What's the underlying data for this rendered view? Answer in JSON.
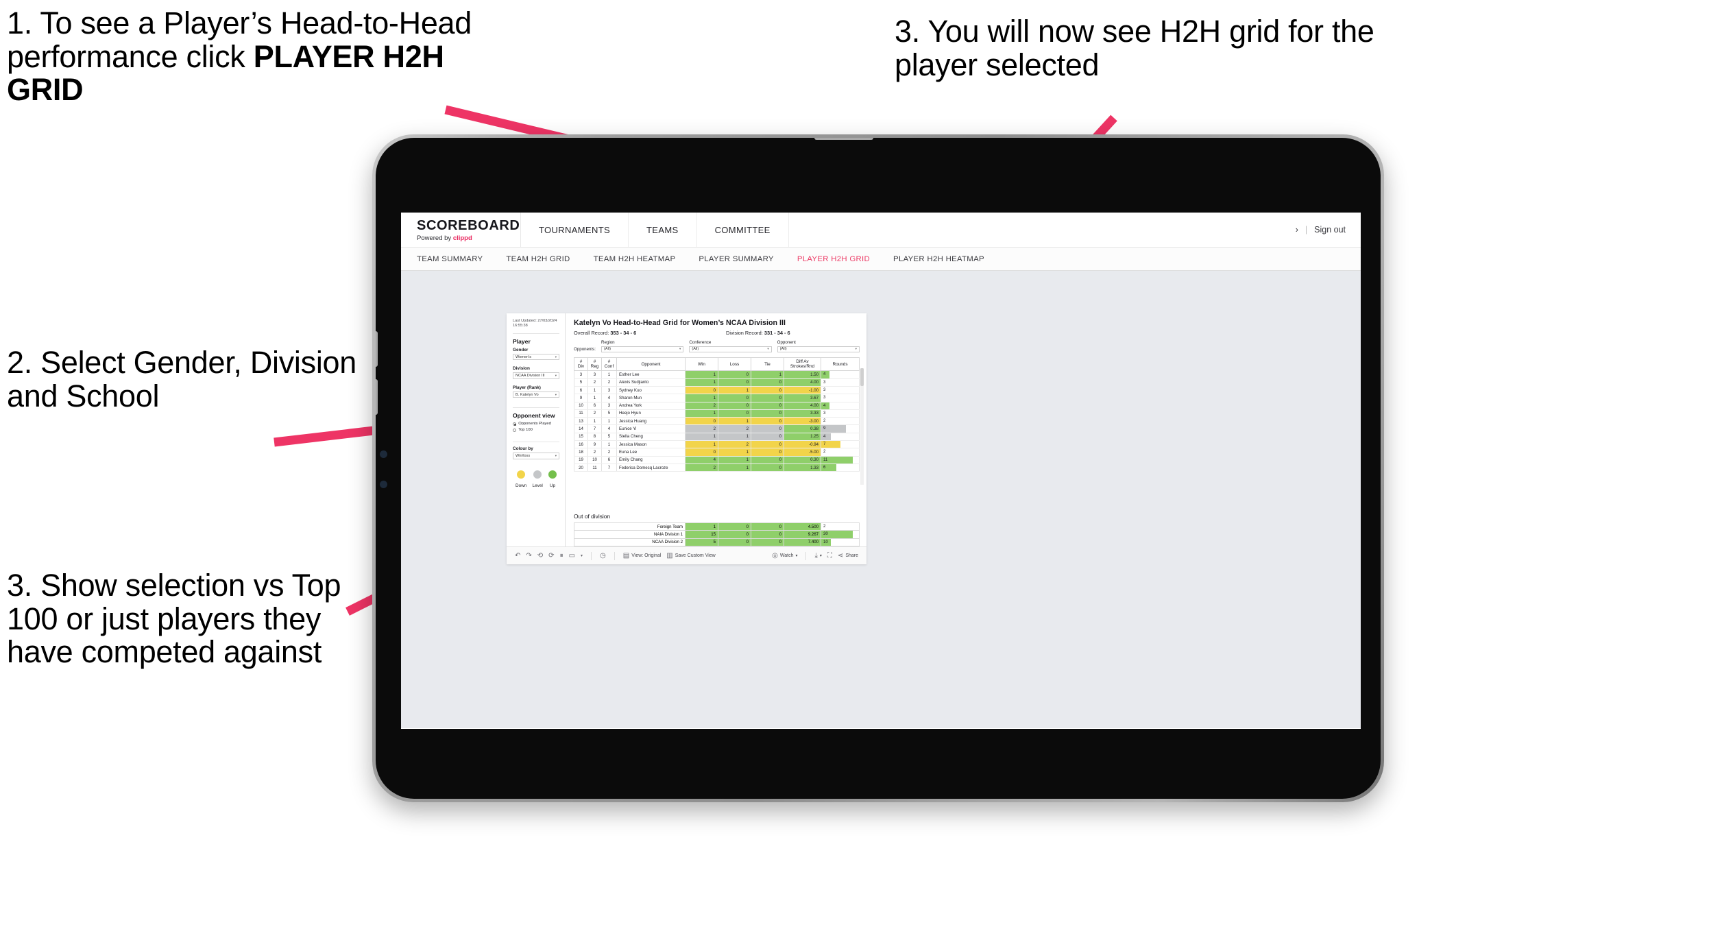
{
  "annotations": {
    "step1_pre": "1. To see a Player’s Head-to-Head performance click ",
    "step1_bold": "PLAYER H2H GRID",
    "step2": "2. Select Gender, Division and School",
    "step3_left": "3. Show selection vs Top 100 or just players they have competed against",
    "step3_right": "3. You will now see H2H grid for the player selected"
  },
  "app": {
    "brand": {
      "title": "SCOREBOARD",
      "powered_prefix": "Powered by ",
      "powered_brand": "clippd"
    },
    "topnav": [
      "TOURNAMENTS",
      "TEAMS",
      "COMMITTEE"
    ],
    "top_right": {
      "chevron": "›",
      "separator": "|",
      "sign_out": "Sign out"
    },
    "subnav": [
      {
        "label": "TEAM SUMMARY",
        "active": false
      },
      {
        "label": "TEAM H2H GRID",
        "active": false
      },
      {
        "label": "TEAM H2H HEATMAP",
        "active": false
      },
      {
        "label": "PLAYER SUMMARY",
        "active": false
      },
      {
        "label": "PLAYER H2H GRID",
        "active": true
      },
      {
        "label": "PLAYER H2H HEATMAP",
        "active": false
      }
    ],
    "accent_pink": "#ec3b66"
  },
  "sidebar": {
    "last_updated_line1": "Last Updated: 27/03/2024",
    "last_updated_line2": "16:55:38",
    "player_heading": "Player",
    "filters": [
      {
        "label": "Gender",
        "value": "Women's"
      },
      {
        "label": "Division",
        "value": "NCAA Division III"
      },
      {
        "label": "Player (Rank)",
        "value": "B. Katelyn Vo"
      }
    ],
    "opponent_view": {
      "heading": "Opponent view",
      "options": [
        {
          "label": "Opponents Played",
          "selected": true
        },
        {
          "label": "Top 100",
          "selected": false
        }
      ]
    },
    "colour_by": {
      "label": "Colour by",
      "value": "Win/loss"
    },
    "legend": [
      {
        "label": "Down",
        "color": "#f2d44a"
      },
      {
        "label": "Level",
        "color": "#c4c6c8"
      },
      {
        "label": "Up",
        "color": "#74bf4b"
      }
    ]
  },
  "main": {
    "title": "Katelyn Vo Head-to-Head Grid for Women’s NCAA Division III",
    "overall_record_label": "Overall Record: ",
    "overall_record_value": "353 -  34 - 6",
    "division_record_label": "Division Record: ",
    "division_record_value": "331 -  34 - 6",
    "opponents_label": "Opponents:",
    "opponent_filters": [
      {
        "label": "Region",
        "value": "(All)"
      },
      {
        "label": "Conference",
        "value": "(All)"
      },
      {
        "label": "Opponent",
        "value": "(All)"
      }
    ],
    "columns": [
      "# Div",
      "# Reg",
      "# Conf",
      "Opponent",
      "Win",
      "Loss",
      "Tie",
      "Diff Av Strokes/Rnd",
      "Rounds"
    ],
    "rows": [
      {
        "div": "3",
        "reg": "3",
        "conf": "1",
        "opponent": "Esther Lee",
        "win": "1",
        "loss": "0",
        "tie": "1",
        "diff": "1.50",
        "rounds": "4",
        "color": "#8fcf6a",
        "bar_pct": 21
      },
      {
        "div": "5",
        "reg": "2",
        "conf": "2",
        "opponent": "Alexis Sudjianto",
        "win": "1",
        "loss": "0",
        "tie": "0",
        "diff": "4.00",
        "rounds": "3",
        "color": "#8fcf6a",
        "bar_pct": 0
      },
      {
        "div": "6",
        "reg": "1",
        "conf": "3",
        "opponent": "Sydney Kuo",
        "win": "0",
        "loss": "1",
        "tie": "0",
        "diff": "-1.00",
        "rounds": "3",
        "color": "#f2d44a",
        "bar_pct": 0
      },
      {
        "div": "9",
        "reg": "1",
        "conf": "4",
        "opponent": "Sharon Mun",
        "win": "1",
        "loss": "0",
        "tie": "0",
        "diff": "3.67",
        "rounds": "3",
        "color": "#8fcf6a",
        "bar_pct": 0
      },
      {
        "div": "10",
        "reg": "6",
        "conf": "3",
        "opponent": "Andrea York",
        "win": "2",
        "loss": "0",
        "tie": "0",
        "diff": "4.00",
        "rounds": "4",
        "color": "#8fcf6a",
        "bar_pct": 21
      },
      {
        "div": "11",
        "reg": "2",
        "conf": "5",
        "opponent": "Heejo Hyun",
        "win": "1",
        "loss": "0",
        "tie": "0",
        "diff": "3.33",
        "rounds": "3",
        "color": "#8fcf6a",
        "bar_pct": 0
      },
      {
        "div": "13",
        "reg": "1",
        "conf": "1",
        "opponent": "Jessica Huang",
        "win": "0",
        "loss": "1",
        "tie": "0",
        "diff": "-3.00",
        "rounds": "2",
        "color": "#f2d44a",
        "bar_pct": 0
      },
      {
        "div": "14",
        "reg": "7",
        "conf": "4",
        "opponent": "Eunice Yi",
        "win": "2",
        "loss": "2",
        "tie": "0",
        "diff": "0.38",
        "rounds": "9",
        "color": "#c4c6c8",
        "diff_color": "#8fcf6a",
        "bar_pct": 66
      },
      {
        "div": "15",
        "reg": "8",
        "conf": "5",
        "opponent": "Stella Cheng",
        "win": "1",
        "loss": "1",
        "tie": "0",
        "diff": "1.25",
        "rounds": "4",
        "color": "#c4c6c8",
        "diff_color": "#8fcf6a",
        "bar_pct": 25
      },
      {
        "div": "16",
        "reg": "9",
        "conf": "1",
        "opponent": "Jessica Mason",
        "win": "1",
        "loss": "2",
        "tie": "0",
        "diff": "-0.94",
        "rounds": "7",
        "color": "#f2d44a",
        "bar_pct": 50
      },
      {
        "div": "18",
        "reg": "2",
        "conf": "2",
        "opponent": "Euna Lee",
        "win": "0",
        "loss": "1",
        "tie": "0",
        "diff": "-5.00",
        "rounds": "2",
        "color": "#f2d44a",
        "bar_pct": 0
      },
      {
        "div": "19",
        "reg": "10",
        "conf": "6",
        "opponent": "Emily Chang",
        "win": "4",
        "loss": "1",
        "tie": "0",
        "diff": "0.30",
        "rounds": "11",
        "color": "#8fcf6a",
        "bar_pct": 84
      },
      {
        "div": "20",
        "reg": "11",
        "conf": "7",
        "opponent": "Federica Domecq Lacroze",
        "win": "2",
        "loss": "1",
        "tie": "0",
        "diff": "1.33",
        "rounds": "6",
        "color": "#8fcf6a",
        "bar_pct": 40
      }
    ],
    "out_of_division": {
      "title": "Out of division",
      "rows": [
        {
          "label": "Foreign Team",
          "win": "1",
          "loss": "0",
          "tie": "0",
          "diff": "4.500",
          "rounds": "2",
          "color": "#8fcf6a",
          "bar_pct": 0
        },
        {
          "label": "NAIA Division 1",
          "win": "15",
          "loss": "0",
          "tie": "0",
          "diff": "9.267",
          "rounds": "30",
          "color": "#8fcf6a",
          "bar_pct": 84
        },
        {
          "label": "NCAA Division 2",
          "win": "5",
          "loss": "0",
          "tie": "0",
          "diff": "7.400",
          "rounds": "10",
          "color": "#8fcf6a",
          "bar_pct": 26
        }
      ]
    }
  },
  "toolbar": {
    "undo": "↶",
    "redo": "↷",
    "revert": "⟲",
    "refresh": "⏱",
    "pause": "⏸",
    "view_label": "View: Original",
    "save_custom_view": "Save Custom View",
    "watch": "Watch",
    "watch_caret": "▾",
    "download_caret": "▾",
    "share": "Share"
  }
}
